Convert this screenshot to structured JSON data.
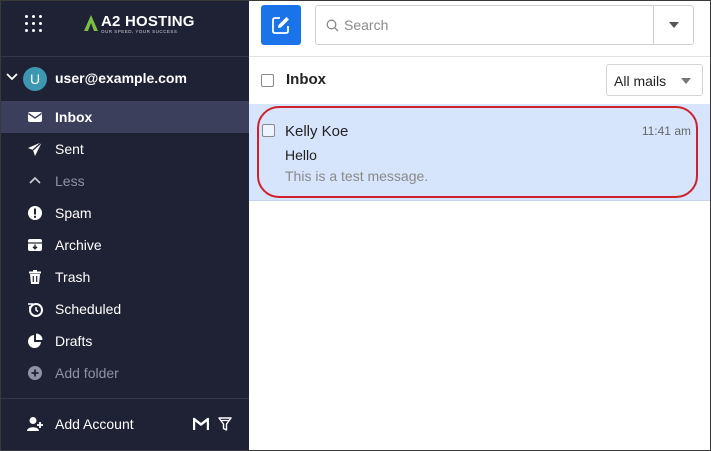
{
  "brand": {
    "name": "A2 HOSTING",
    "tagline": "OUR SPEED, YOUR SUCCESS"
  },
  "account": {
    "avatar_letter": "U",
    "email": "user@example.com"
  },
  "sidebar": {
    "items": [
      {
        "label": "Inbox",
        "icon": "envelope-icon"
      },
      {
        "label": "Sent",
        "icon": "paper-plane-icon"
      },
      {
        "label": "Less",
        "icon": "chevron-up-icon"
      },
      {
        "label": "Spam",
        "icon": "exclamation-circle-icon"
      },
      {
        "label": "Archive",
        "icon": "archive-box-icon"
      },
      {
        "label": "Trash",
        "icon": "trash-icon"
      },
      {
        "label": "Scheduled",
        "icon": "scheduled-clock-icon"
      },
      {
        "label": "Drafts",
        "icon": "drafts-pie-icon"
      },
      {
        "label": "Add folder",
        "icon": "plus-circle-icon"
      }
    ],
    "add_account_label": "Add Account"
  },
  "toolbar": {
    "search_placeholder": "Search"
  },
  "list": {
    "title": "Inbox",
    "filter_value": "All mails",
    "messages": [
      {
        "sender": "Kelly Koe",
        "time": "11:41 am",
        "subject": "Hello",
        "preview": "This is a test message."
      }
    ]
  },
  "colors": {
    "sidebar_bg": "#1f2134",
    "sidebar_active": "#3c3f5b",
    "accent": "#1a73e8",
    "avatar": "#3c97b0",
    "selected_row": "#d6e5fb",
    "highlight": "#d0202e"
  }
}
